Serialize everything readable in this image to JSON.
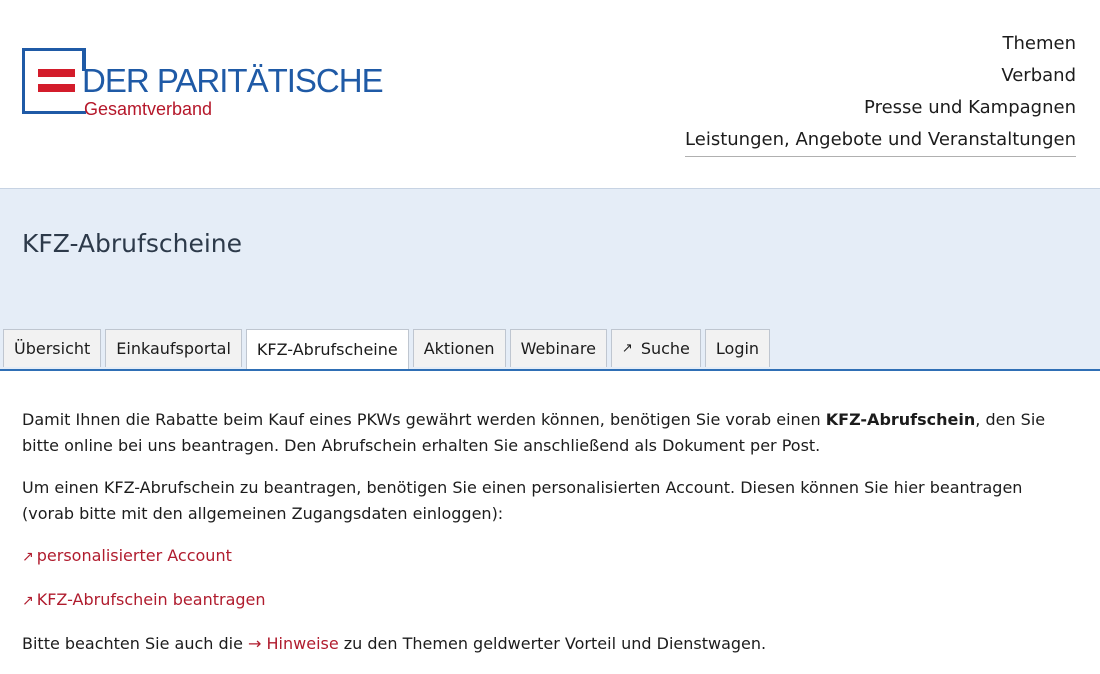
{
  "logo": {
    "title": "DER PARITÄTISCHE",
    "subtitle": "Gesamtverband"
  },
  "topnav": [
    "Themen",
    "Verband",
    "Presse und Kampagnen",
    "Leistungen, Angebote und Veranstaltungen"
  ],
  "page_title": "KFZ-Abrufscheine",
  "tabs": {
    "t0": "Übersicht",
    "t1": "Einkaufsportal",
    "t2": "KFZ-Abrufscheine",
    "t3": "Aktionen",
    "t4": "Webinare",
    "t5": "Suche",
    "t6": "Login",
    "active": "KFZ-Abrufscheine"
  },
  "content": {
    "p1_pre": "Damit Ihnen die Rabatte beim Kauf eines PKWs gewährt werden können, benötigen Sie vorab einen ",
    "p1_bold": "KFZ-Abrufschein",
    "p1_post": ", den Sie bitte online bei uns beantragen. Den Abrufschein erhalten Sie anschließend als Dokument per Post.",
    "p2": "Um einen KFZ-Abrufschein zu beantragen, benötigen Sie einen personalisierten Account. Diesen können Sie hier beantragen (vorab bitte mit den allgemeinen Zugangsdaten einloggen):",
    "link1": "personalisierter Account",
    "link2": "KFZ-Abrufschein beantragen",
    "p3_pre": "Bitte beachten Sie auch die ",
    "p3_link": "Hinweise",
    "p3_post": " zu den Themen geldwerter Vorteil und Dienstwagen."
  },
  "icons": {
    "external": "external-link-icon",
    "arrow": "arrow-right-icon"
  },
  "colors": {
    "brand_blue": "#1f5aa6",
    "brand_red": "#d31c2b",
    "link_red": "#b01c2e",
    "banner_bg": "#e5edf7"
  }
}
